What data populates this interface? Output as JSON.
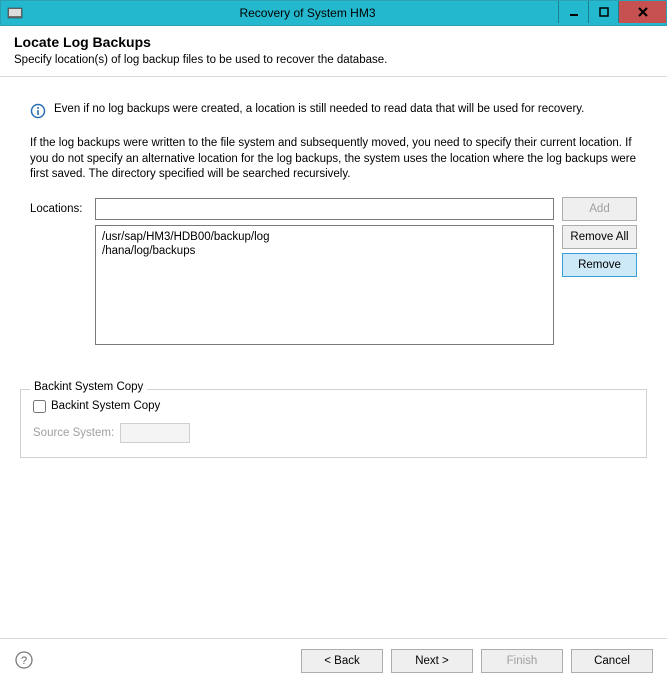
{
  "window": {
    "title": "Recovery of System HM3"
  },
  "header": {
    "title": "Locate Log Backups",
    "subtitle": "Specify location(s) of log backup files to be used to recover the database."
  },
  "info": "Even if no log backups were created, a location is still needed to read data that will be used for recovery.",
  "paragraph": "If the log backups were written to the file system and subsequently moved, you need to specify their current location. If you do not specify an alternative location for the log backups, the system uses the location where the log backups were first saved. The directory specified will be searched recursively.",
  "locations": {
    "label": "Locations:",
    "input_value": "",
    "items": [
      "/usr/sap/HM3/HDB00/backup/log",
      "/hana/log/backups"
    ]
  },
  "buttons": {
    "add": "Add",
    "remove_all": "Remove All",
    "remove": "Remove"
  },
  "backint": {
    "group_label": "Backint System Copy",
    "checkbox_label": "Backint System Copy",
    "source_label": "Source System:",
    "source_value": ""
  },
  "nav": {
    "back": "< Back",
    "next": "Next >",
    "finish": "Finish",
    "cancel": "Cancel"
  }
}
